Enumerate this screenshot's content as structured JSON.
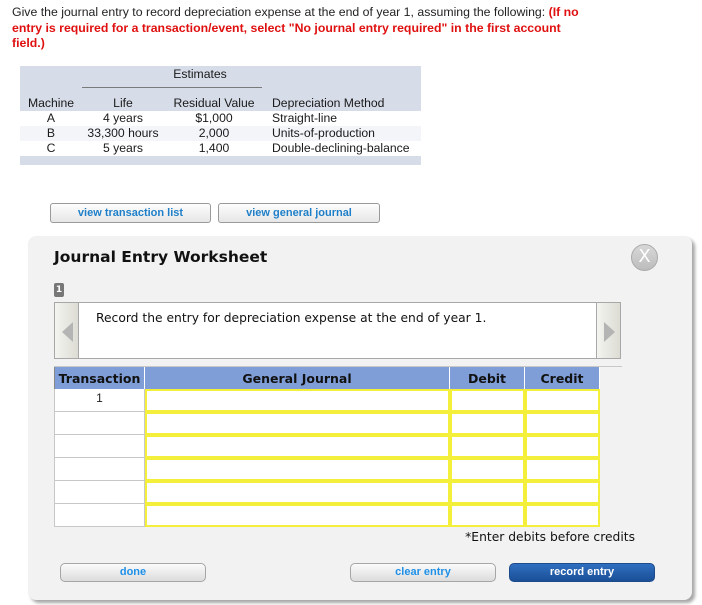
{
  "question": {
    "text": "Give the journal entry to record depreciation expense at the end of year 1, assuming the following:",
    "note": "(If no entry is required for a transaction/event, select \"No journal entry required\" in the first account field.)"
  },
  "estimates": {
    "group_header": "Estimates",
    "columns": [
      "Machine",
      "Life",
      "Residual Value",
      "Depreciation Method"
    ],
    "rows": [
      {
        "machine": "A",
        "life": "4 years",
        "residual": "$1,000",
        "method": "Straight-line"
      },
      {
        "machine": "B",
        "life": "33,300 hours",
        "residual": "2,000",
        "method": "Units-of-production"
      },
      {
        "machine": "C",
        "life": "5 years",
        "residual": "1,400",
        "method": "Double-declining-balance"
      }
    ]
  },
  "buttons": {
    "view_transaction_list": "view transaction list",
    "view_general_journal": "view general journal"
  },
  "worksheet": {
    "title": "Journal Entry Worksheet",
    "close_label": "X",
    "step_number": "1",
    "prompt": "Record the entry for depreciation expense at the end of year 1.",
    "columns": {
      "transaction": "Transaction",
      "general_journal": "General Journal",
      "debit": "Debit",
      "credit": "Credit"
    },
    "rows": [
      {
        "transaction": "1",
        "account": "",
        "debit": "",
        "credit": ""
      },
      {
        "transaction": "",
        "account": "",
        "debit": "",
        "credit": ""
      },
      {
        "transaction": "",
        "account": "",
        "debit": "",
        "credit": ""
      },
      {
        "transaction": "",
        "account": "",
        "debit": "",
        "credit": ""
      },
      {
        "transaction": "",
        "account": "",
        "debit": "",
        "credit": ""
      },
      {
        "transaction": "",
        "account": "",
        "debit": "",
        "credit": ""
      }
    ],
    "hint": "*Enter debits before credits",
    "done_label": "done",
    "clear_label": "clear entry",
    "record_label": "record entry"
  },
  "colors": {
    "note_red": "#e01010",
    "header_blue": "#7f9ed8",
    "cell_border_yellow": "#f3ef3a",
    "link_blue": "#1e7fc8",
    "record_button": "#2f6fc0"
  }
}
